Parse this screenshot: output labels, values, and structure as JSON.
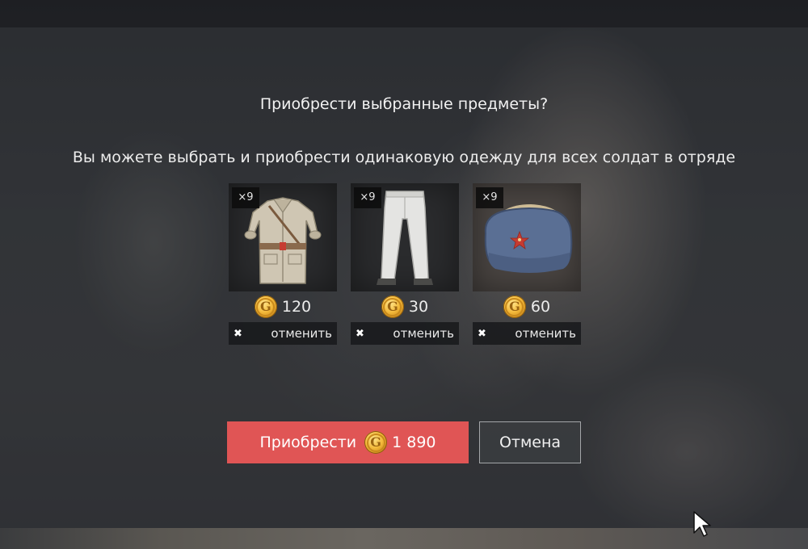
{
  "dialog": {
    "title": "Приобрести выбранные предметы?",
    "subtitle": "Вы можете выбрать и приобрести одинаковую одежду для всех солдат в отряде"
  },
  "items": [
    {
      "name": "tunic",
      "icon": "tunic-icon",
      "quantity": "×9",
      "price": "120",
      "cancel_label": "отменить"
    },
    {
      "name": "trousers",
      "icon": "trousers-icon",
      "quantity": "×9",
      "price": "30",
      "cancel_label": "отменить"
    },
    {
      "name": "ushanka",
      "icon": "ushanka-hat-icon",
      "quantity": "×9",
      "price": "60",
      "cancel_label": "отменить"
    }
  ],
  "currency": {
    "symbol": "G",
    "icon": "gold-coin-icon"
  },
  "buttons": {
    "buy_label": "Приобрести",
    "buy_total": "1 890",
    "cancel_label": "Отмена"
  },
  "colors": {
    "buy_button": "#e05555",
    "coin": "#f3b93a"
  }
}
